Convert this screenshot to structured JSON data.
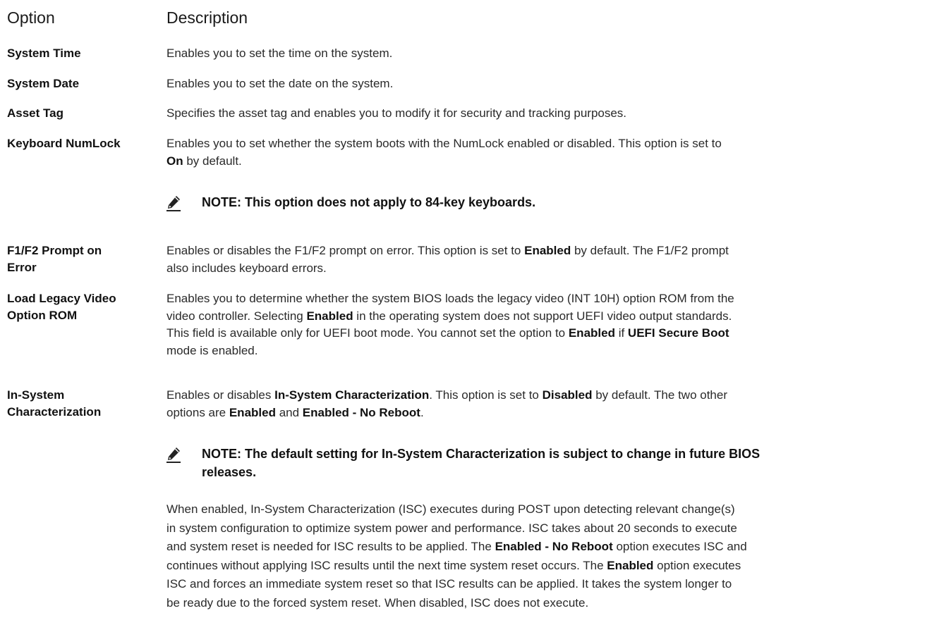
{
  "headers": {
    "option": "Option",
    "description": "Description"
  },
  "rows": [
    {
      "option": "System Time",
      "desc": "Enables you to set the time on the system."
    },
    {
      "option": "System Date",
      "desc": "Enables you to set the date on the system."
    },
    {
      "option": "Asset Tag",
      "desc": "Specifies the asset tag and enables you to modify it for security and tracking purposes."
    },
    {
      "option": "Keyboard NumLock",
      "desc_l1": "Enables you to set whether the system boots with the NumLock enabled or disabled. This option is set to",
      "desc_l2_b": "On",
      "desc_l2": " by default.",
      "note": "NOTE: This option does not apply to 84-key keyboards."
    },
    {
      "option_l1": "F1/F2 Prompt on",
      "option_l2": "Error",
      "desc_l1_a": "Enables or disables the F1/F2 prompt on error. This option is set to ",
      "desc_l1_b": "Enabled",
      "desc_l1_c": " by default. The F1/F2 prompt",
      "desc_l2": "also includes keyboard errors."
    },
    {
      "option_l1": "Load Legacy Video",
      "option_l2": "Option ROM",
      "desc_l1": "Enables you to determine whether the system BIOS loads the legacy video (INT 10H) option ROM from the",
      "desc_l2_a": "video controller. Selecting ",
      "desc_l2_b": "Enabled",
      "desc_l2_c": " in the operating system does not support UEFI video output standards.",
      "desc_l3_a": "This field is available only for UEFI boot mode. You cannot set the option to ",
      "desc_l3_b": "Enabled",
      "desc_l3_c": " if ",
      "desc_l3_d": "UEFI Secure Boot",
      "desc_l4": "mode is enabled."
    },
    {
      "option_l1": "In-System",
      "option_l2": "Characterization",
      "desc_l1_a": "Enables or disables ",
      "desc_l1_b": "In-System Characterization",
      "desc_l1_c": ". This option is set to ",
      "desc_l1_d": "Disabled",
      "desc_l1_e": " by default. The two other",
      "desc_l2_a": "options are ",
      "desc_l2_b": "Enabled",
      "desc_l2_c": " and ",
      "desc_l2_d": "Enabled - No Reboot",
      "desc_l2_e": ".",
      "note_l1": "NOTE: The default setting for In-System Characterization is subject to change in future BIOS",
      "note_l2": "releases.",
      "p_l1": "When enabled, In-System Characterization (ISC) executes during POST upon detecting relevant change(s)",
      "p_l2": "in system configuration to optimize system power and performance. ISC takes about 20 seconds to execute",
      "p_l3_a": "and system reset is needed for ISC results to be applied. The ",
      "p_l3_b": "Enabled - No Reboot",
      "p_l3_c": " option executes ISC and",
      "p_l4_a": "continues without applying ISC results until the next time system reset occurs. The ",
      "p_l4_b": "Enabled",
      "p_l4_c": " option executes",
      "p_l5": "ISC and forces an immediate system reset so that ISC results can be applied. It takes the system longer to",
      "p_l6": "be ready due to the forced system reset. When disabled, ISC does not execute."
    }
  ],
  "icons": {
    "note_icon": "pencil-note-icon"
  }
}
